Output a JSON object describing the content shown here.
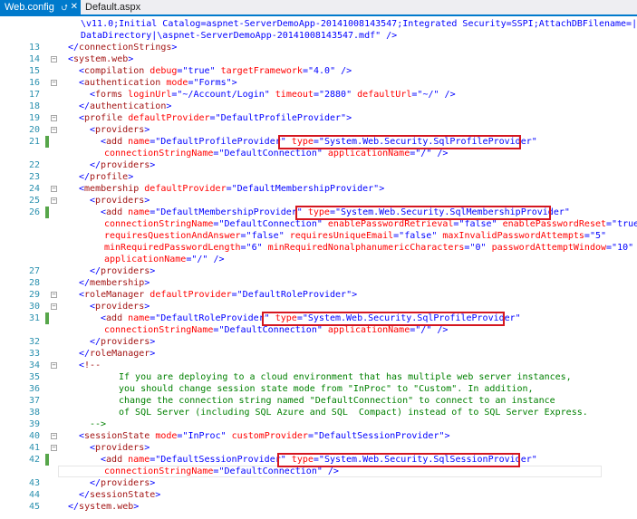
{
  "tabs": [
    {
      "label": "Web.config",
      "active": true
    },
    {
      "label": "Default.aspx",
      "active": false
    }
  ],
  "tab_icons": {
    "pin": "pin-icon",
    "close": "close-icon"
  },
  "colors": {
    "accent": "#007acc",
    "line_number": "#2b91af",
    "tag": "#a31515",
    "attribute": "#ff0000",
    "value": "#0000ff",
    "comment": "#008000",
    "highlight_box": "#d4161f",
    "change_bar": "#57a64a"
  },
  "code": {
    "lines": [
      {
        "num": "",
        "text": "\\v11.0;Initial Catalog=aspnet-ServerDemoApp-20141008143547;Integrated Security=SSPI;AttachDBFilename=|",
        "kind": "value"
      },
      {
        "num": "",
        "text": "DataDirectory|\\aspnet-ServerDemoApp-20141008143547.mdf\" />",
        "kind": "value"
      },
      {
        "num": "13",
        "text": "</connectionStrings>"
      },
      {
        "num": "14",
        "text": "<system.web>"
      },
      {
        "num": "15",
        "text": "<compilation debug=\"true\" targetFramework=\"4.0\" />"
      },
      {
        "num": "16",
        "text": "<authentication mode=\"Forms\">"
      },
      {
        "num": "17",
        "text": "<forms loginUrl=\"~/Account/Login\" timeout=\"2880\" defaultUrl=\"~/\" />"
      },
      {
        "num": "18",
        "text": "</authentication>"
      },
      {
        "num": "19",
        "text": "<profile defaultProvider=\"DefaultProfileProvider\">"
      },
      {
        "num": "20",
        "text": "<providers>"
      },
      {
        "num": "21",
        "text": "<add name=\"DefaultProfileProvider\" type=\"System.Web.Security.SqlProfileProvider\""
      },
      {
        "num": "",
        "text": "connectionStringName=\"DefaultConnection\" applicationName=\"/\" />"
      },
      {
        "num": "22",
        "text": "</providers>"
      },
      {
        "num": "23",
        "text": "</profile>"
      },
      {
        "num": "24",
        "text": "<membership defaultProvider=\"DefaultMembershipProvider\">"
      },
      {
        "num": "25",
        "text": "<providers>"
      },
      {
        "num": "26",
        "text": "<add name=\"DefaultMembershipProvider\" type=\"System.Web.Security.SqlMembershipProvider\""
      },
      {
        "num": "",
        "text": "connectionStringName=\"DefaultConnection\" enablePasswordRetrieval=\"false\" enablePasswordReset=\"true\""
      },
      {
        "num": "",
        "text": "requiresQuestionAndAnswer=\"false\" requiresUniqueEmail=\"false\" maxInvalidPasswordAttempts=\"5\""
      },
      {
        "num": "",
        "text": "minRequiredPasswordLength=\"6\" minRequiredNonalphanumericCharacters=\"0\" passwordAttemptWindow=\"10\""
      },
      {
        "num": "",
        "text": "applicationName=\"/\" />"
      },
      {
        "num": "27",
        "text": "</providers>"
      },
      {
        "num": "28",
        "text": "</membership>"
      },
      {
        "num": "29",
        "text": "<roleManager defaultProvider=\"DefaultRoleProvider\">"
      },
      {
        "num": "30",
        "text": "<providers>"
      },
      {
        "num": "31",
        "text": "<add name=\"DefaultRoleProvider\" type=\"System.Web.Security.SqlProfileProvider\""
      },
      {
        "num": "",
        "text": "connectionStringName=\"DefaultConnection\" applicationName=\"/\" />"
      },
      {
        "num": "32",
        "text": "</providers>"
      },
      {
        "num": "33",
        "text": "</roleManager>"
      },
      {
        "num": "34",
        "text": "<!--"
      },
      {
        "num": "35",
        "text": "If you are deploying to a cloud environment that has multiple web server instances,",
        "kind": "comment"
      },
      {
        "num": "36",
        "text": "you should change session state mode from \"InProc\" to \"Custom\". In addition,",
        "kind": "comment"
      },
      {
        "num": "37",
        "text": "change the connection string named \"DefaultConnection\" to connect to an instance",
        "kind": "comment"
      },
      {
        "num": "38",
        "text": "of SQL Server (including SQL Azure and SQL  Compact) instead of to SQL Server Express.",
        "kind": "comment"
      },
      {
        "num": "39",
        "text": "-->",
        "kind": "comment"
      },
      {
        "num": "40",
        "text": "<sessionState mode=\"InProc\" customProvider=\"DefaultSessionProvider\">"
      },
      {
        "num": "41",
        "text": "<providers>"
      },
      {
        "num": "42",
        "text": "<add name=\"DefaultSessionProvider\" type=\"System.Web.Security.SqlSessionProvider\""
      },
      {
        "num": "",
        "text": "connectionStringName=\"DefaultConnection\" />"
      },
      {
        "num": "43",
        "text": "</providers>"
      },
      {
        "num": "44",
        "text": "</sessionState>"
      },
      {
        "num": "45",
        "text": "</system.web>"
      }
    ]
  }
}
